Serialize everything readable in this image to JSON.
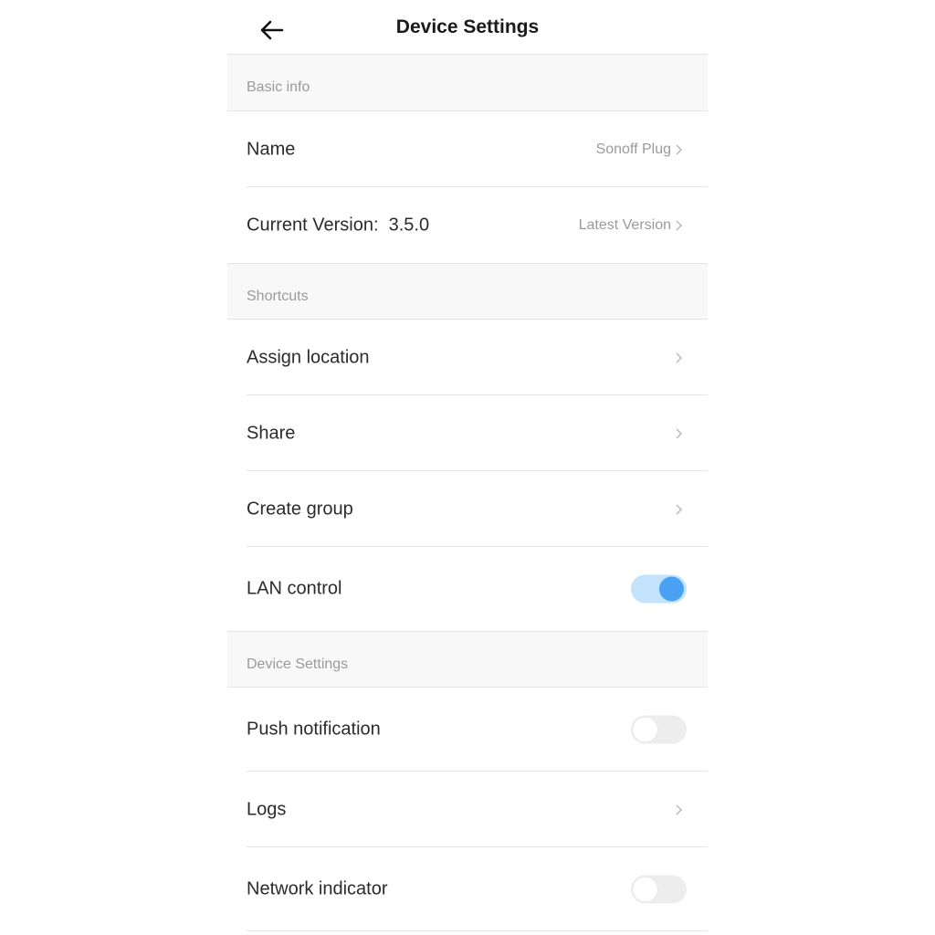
{
  "header": {
    "title": "Device Settings",
    "back_icon": "arrow-left-icon"
  },
  "sections": {
    "basic_info": "Basic info",
    "shortcuts": "Shortcuts",
    "device_settings": "Device Settings"
  },
  "rows": {
    "name": {
      "label": "Name",
      "value": "Sonoff Plug"
    },
    "version": {
      "label": "Current Version:  3.5.0",
      "value": "Latest Version"
    },
    "assign_location": {
      "label": "Assign location"
    },
    "share": {
      "label": "Share"
    },
    "create_group": {
      "label": "Create group"
    },
    "lan_control": {
      "label": "LAN control",
      "enabled": true
    },
    "push_notification": {
      "label": "Push notification",
      "enabled": false
    },
    "logs": {
      "label": "Logs"
    },
    "network_indicator": {
      "label": "Network indicator",
      "enabled": false
    }
  },
  "colors": {
    "toggle_on_track": "#c3e2fb",
    "toggle_on_knob": "#4aa0f2",
    "toggle_off_track": "#ededed"
  }
}
